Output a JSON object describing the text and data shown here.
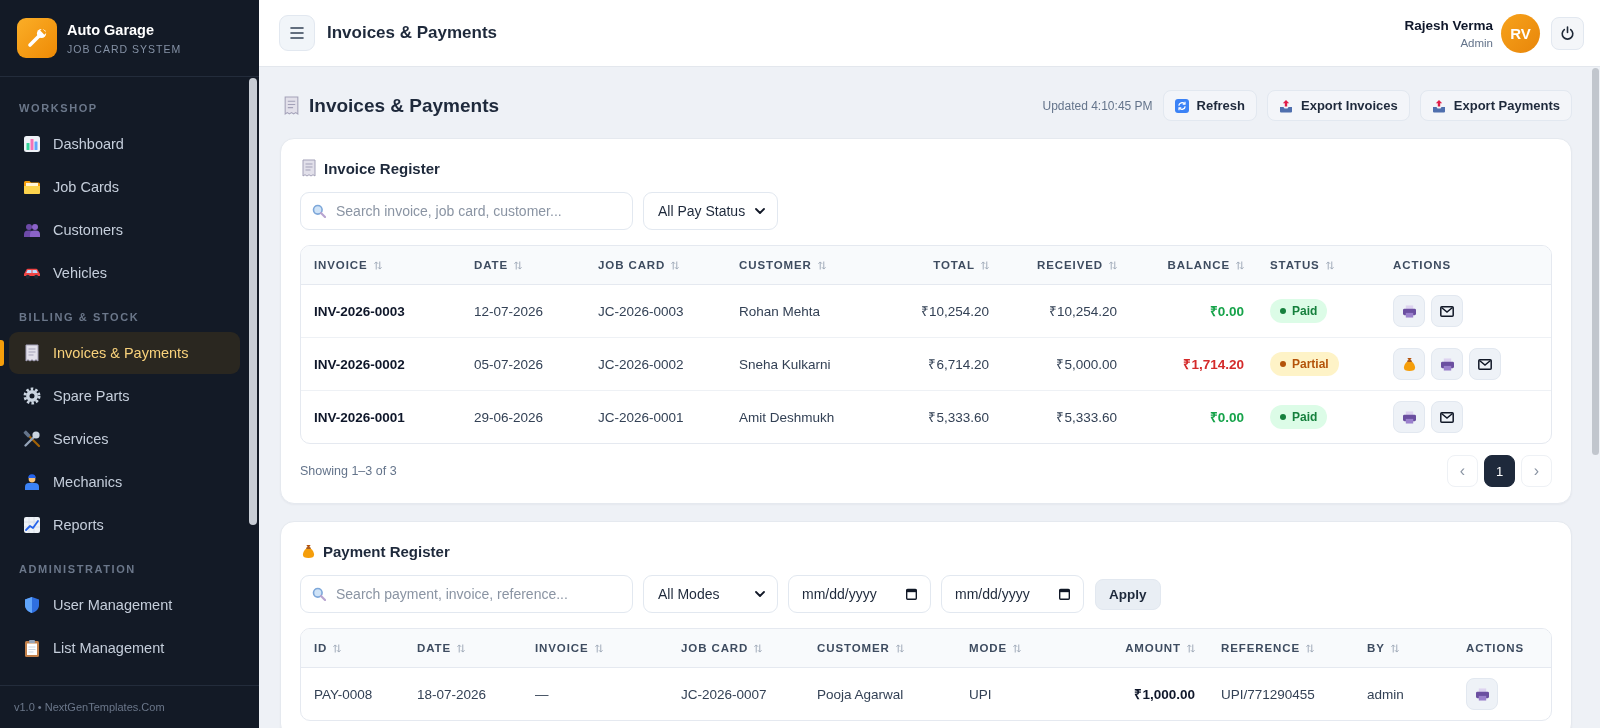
{
  "sidebar": {
    "brand": {
      "title": "Auto Garage",
      "subtitle": "JOB CARD SYSTEM"
    },
    "sections": [
      {
        "heading": "WORKSHOP",
        "items": [
          {
            "label": "Dashboard",
            "selected": false
          },
          {
            "label": "Job Cards",
            "selected": false
          },
          {
            "label": "Customers",
            "selected": false
          },
          {
            "label": "Vehicles",
            "selected": false
          }
        ]
      },
      {
        "heading": "BILLING & STOCK",
        "items": [
          {
            "label": "Invoices & Payments",
            "selected": true
          },
          {
            "label": "Spare Parts",
            "selected": false
          },
          {
            "label": "Services",
            "selected": false
          },
          {
            "label": "Mechanics",
            "selected": false
          },
          {
            "label": "Reports",
            "selected": false
          }
        ]
      },
      {
        "heading": "ADMINISTRATION",
        "items": [
          {
            "label": "User Management",
            "selected": false
          },
          {
            "label": "List Management",
            "selected": false
          }
        ]
      }
    ],
    "footer": "v1.0 • NextGenTemplates.Com"
  },
  "topbar": {
    "title": "Invoices & Payments",
    "user": {
      "name": "Rajesh Verma",
      "role": "Admin",
      "initials": "RV"
    }
  },
  "page": {
    "title": "Invoices & Payments",
    "updated": "Updated 4:10:45 PM",
    "actions": [
      {
        "label": "Refresh",
        "kind": "refresh"
      },
      {
        "label": "Export Invoices",
        "kind": "export"
      },
      {
        "label": "Export Payments",
        "kind": "export"
      }
    ]
  },
  "invoice_register": {
    "title": "Invoice Register",
    "search": {
      "placeholder": "Search invoice, job card, customer..."
    },
    "status_filter": {
      "value": "All Pay Status"
    },
    "columns": [
      {
        "label": "INVOICE",
        "sortable": true
      },
      {
        "label": "DATE",
        "sortable": true
      },
      {
        "label": "JOB CARD",
        "sortable": true
      },
      {
        "label": "CUSTOMER",
        "sortable": true
      },
      {
        "label": "TOTAL",
        "sortable": true
      },
      {
        "label": "RECEIVED",
        "sortable": true
      },
      {
        "label": "BALANCE",
        "sortable": true
      },
      {
        "label": "STATUS",
        "sortable": true
      },
      {
        "label": "ACTIONS",
        "sortable": false
      }
    ],
    "rows": [
      {
        "invoice": "INV-2026-0003",
        "date": "12-07-2026",
        "job_card": "JC-2026-0003",
        "customer": "Rohan Mehta",
        "total": "₹10,254.20",
        "received": "₹10,254.20",
        "balance": "₹0.00",
        "balance_due": false,
        "status": {
          "label": "Paid",
          "kind": "paid"
        },
        "actions": [
          {
            "kind": "print"
          },
          {
            "kind": "email"
          }
        ]
      },
      {
        "invoice": "INV-2026-0002",
        "date": "05-07-2026",
        "job_card": "JC-2026-0002",
        "customer": "Sneha Kulkarni",
        "total": "₹6,714.20",
        "received": "₹5,000.00",
        "balance": "₹1,714.20",
        "balance_due": true,
        "status": {
          "label": "Partial",
          "kind": "partial"
        },
        "actions": [
          {
            "kind": "collect"
          },
          {
            "kind": "print"
          },
          {
            "kind": "email"
          }
        ]
      },
      {
        "invoice": "INV-2026-0001",
        "date": "29-06-2026",
        "job_card": "JC-2026-0001",
        "customer": "Amit Deshmukh",
        "total": "₹5,333.60",
        "received": "₹5,333.60",
        "balance": "₹0.00",
        "balance_due": false,
        "status": {
          "label": "Paid",
          "kind": "paid"
        },
        "actions": [
          {
            "kind": "print"
          },
          {
            "kind": "email"
          }
        ]
      }
    ],
    "summary": "Showing 1–3 of 3",
    "pagination": {
      "previous": {
        "label": "‹",
        "disabled": true
      },
      "pages": [
        {
          "label": "1",
          "selected": true
        }
      ],
      "next": {
        "label": "›",
        "disabled": true
      }
    }
  },
  "payment_register": {
    "title": "Payment Register",
    "search": {
      "placeholder": "Search payment, invoice, reference..."
    },
    "mode_filter": {
      "value": "All Modes"
    },
    "date_from": {
      "placeholder": "mm/dd/yyyy"
    },
    "date_to": {
      "placeholder": "mm/dd/yyyy"
    },
    "apply_button": {
      "label": "Apply"
    },
    "columns": [
      {
        "label": "ID",
        "sortable": true
      },
      {
        "label": "DATE",
        "sortable": true
      },
      {
        "label": "INVOICE",
        "sortable": true
      },
      {
        "label": "JOB CARD",
        "sortable": true
      },
      {
        "label": "CUSTOMER",
        "sortable": true
      },
      {
        "label": "MODE",
        "sortable": true
      },
      {
        "label": "AMOUNT",
        "sortable": true
      },
      {
        "label": "REFERENCE",
        "sortable": true
      },
      {
        "label": "BY",
        "sortable": true
      },
      {
        "label": "ACTIONS",
        "sortable": false
      }
    ],
    "rows": [
      {
        "id": "PAY-0008",
        "date": "18-07-2026",
        "invoice": "—",
        "job_card": "JC-2026-0007",
        "customer": "Pooja Agarwal",
        "mode": "UPI",
        "amount": "₹1,000.00",
        "reference": "UPI/771290455",
        "by": "admin",
        "actions": [
          {
            "kind": "print"
          }
        ]
      }
    ]
  }
}
